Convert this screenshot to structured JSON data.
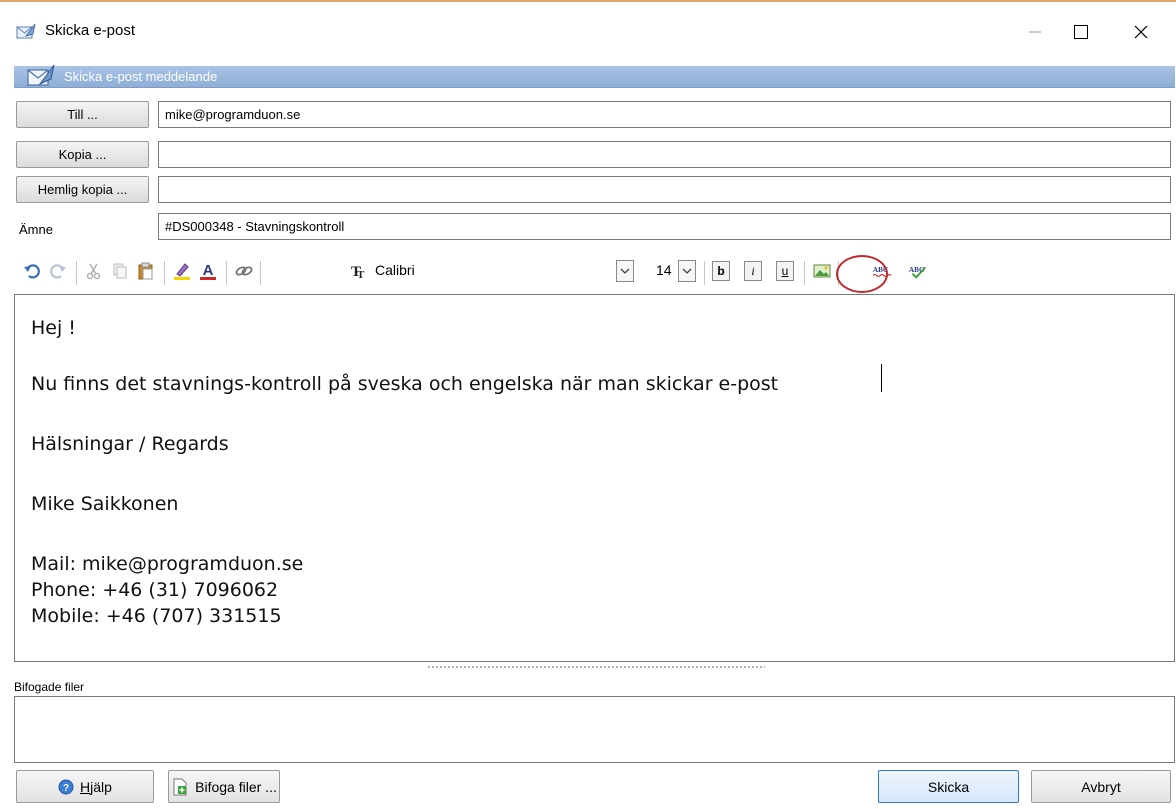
{
  "window": {
    "title": "Skicka e-post",
    "section_title": "Skicka e-post meddelande"
  },
  "fields": {
    "to_label": "Till ...",
    "to_value": "mike@programduon.se",
    "cc_label": "Kopia ...",
    "cc_value": "",
    "bcc_label": "Hemlig kopia ...",
    "bcc_value": "",
    "subject_label": "Ämne",
    "subject_value": "#DS000348 - Stavningskontroll"
  },
  "toolbar": {
    "font_name": "Calibri",
    "font_size": "14",
    "bold": "b",
    "italic": "i",
    "underline": "u",
    "icons": [
      "undo-icon",
      "redo-icon",
      "cut-icon",
      "copy-icon",
      "paste-icon",
      "highlight-icon",
      "font-color-icon",
      "link-icon",
      "font-icon",
      "image-icon",
      "spellcheck-icon",
      "spellcheck-accept-icon"
    ],
    "highlight_color": "#f2d600",
    "font_color": "#d22a2a",
    "circle_color": "#c0282e"
  },
  "body": {
    "lines": [
      "Hej !",
      "Nu finns det stavnings-kontroll på sveska och engelska när man skickar e-post",
      "Hälsningar / Regards",
      "Mike Saikkonen",
      "Mail: mike@programduon.se",
      "Phone: +46 (31) 7096062",
      "Mobile: +46 (707) 331515"
    ]
  },
  "attachments": {
    "label": "Bifogade filer"
  },
  "buttons": {
    "help": "Hjälp",
    "attach": "Bifoga filer ...",
    "send": "Skicka",
    "cancel": "Avbryt"
  },
  "colors": {
    "header_blue": "#8eafd7",
    "accent_border": "#2f7ad1"
  }
}
